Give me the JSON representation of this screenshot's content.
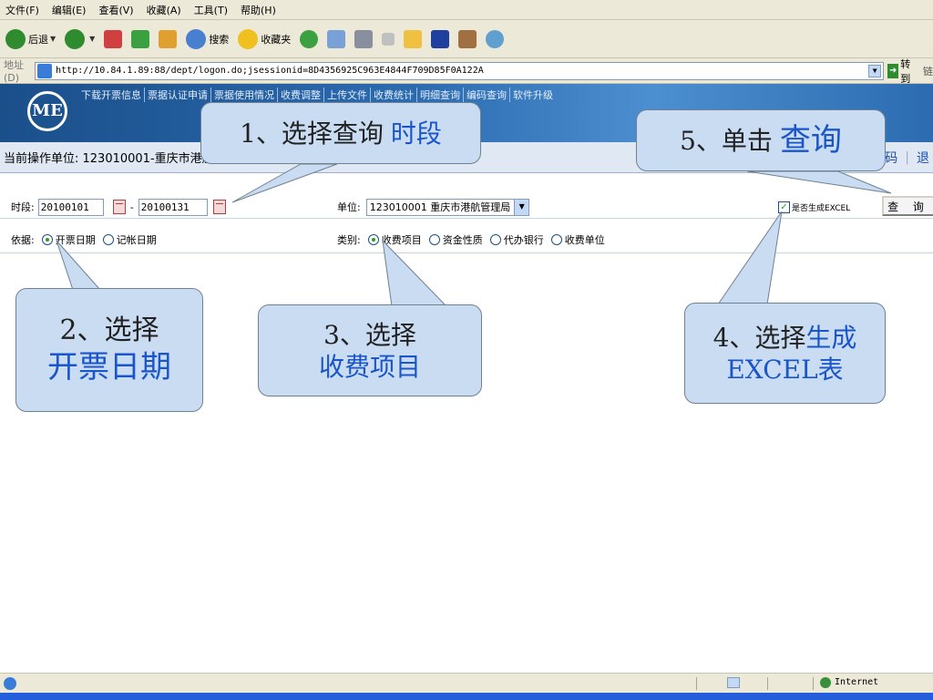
{
  "menu": [
    "文件(F)",
    "编辑(E)",
    "查看(V)",
    "收藏(A)",
    "工具(T)",
    "帮助(H)"
  ],
  "toolbar": {
    "back": "后退",
    "search": "搜索",
    "favorites": "收藏夹"
  },
  "address": {
    "label": "地址(D)",
    "url": "http://10.84.1.89:88/dept/logon.do;jsessionid=8D4356925C963E4844F709D85F0A122A",
    "go": "转到",
    "links": "链"
  },
  "banner": {
    "logo": "ME",
    "nav": [
      "下载开票信息",
      "票据认证申请",
      "票据使用情况",
      "收费调整",
      "上传文件",
      "收费统计",
      "明细查询",
      "编码查询",
      "软件升级"
    ]
  },
  "opbar": {
    "label": "当前操作单位: 123010001-重庆市港航管理局",
    "right1": "码",
    "right2": "退"
  },
  "form": {
    "period_label": "时段:",
    "date_from": "20100101",
    "date_sep": "-",
    "date_to": "20100131",
    "unit_label": "单位:",
    "unit_value": "123010001 重庆市港航管理局",
    "excel_label": "是否生成EXCEL",
    "query_button": "查 询",
    "basis_label": "依据:",
    "basis_options": [
      "开票日期",
      "记帐日期"
    ],
    "category_label": "类别:",
    "category_options": [
      "收费项目",
      "资金性质",
      "代办银行",
      "收费单位"
    ]
  },
  "callouts": {
    "c1_a": "1、选择查询",
    "c1_b": "时段",
    "c2_a": "2、选择",
    "c2_b": "开票日期",
    "c3_a": "3、选择",
    "c3_b": "收费项目",
    "c4_a": "4、选择",
    "c4_b": "生成",
    "c4_c": "EXCEL表",
    "c5_a": "5、单击",
    "c5_b": "查询"
  },
  "status": {
    "zone": "Internet"
  },
  "colors": {
    "banner": "#2c6bb0",
    "callout_fill": "#c9dcf2",
    "callout_highlight": "#1a55c9",
    "link": "#1a4fb5"
  }
}
